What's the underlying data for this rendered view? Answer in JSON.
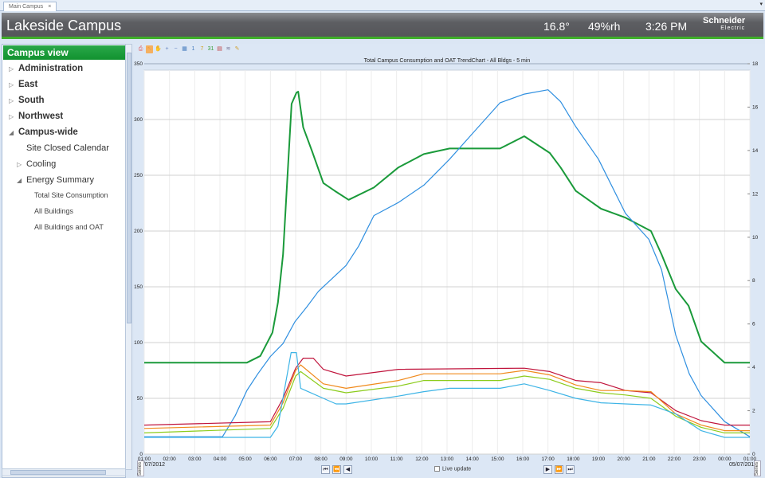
{
  "tab": {
    "label": "Main Campus",
    "close": "×"
  },
  "header": {
    "title": "Lakeside Campus",
    "temperature": "16.8°",
    "humidity": "49%rh",
    "time": "3:26 PM",
    "logo": "Schneider Electric",
    "logo_top": "Schneider",
    "logo_bottom": "Electric"
  },
  "sidebar": {
    "title": "Campus view",
    "items": [
      {
        "label": "Administration",
        "level": 0,
        "expander": "▷"
      },
      {
        "label": "East",
        "level": 0,
        "expander": "▷"
      },
      {
        "label": "South",
        "level": 0,
        "expander": "▷"
      },
      {
        "label": "Northwest",
        "level": 0,
        "expander": "▷"
      },
      {
        "label": "Campus-wide",
        "level": 0,
        "expander": "◢"
      },
      {
        "label": "Site Closed Calendar",
        "level": 1,
        "expander": ""
      },
      {
        "label": "Cooling",
        "level": 1,
        "expander": "▷"
      },
      {
        "label": "Energy Summary",
        "level": 1,
        "expander": "◢"
      },
      {
        "label": "Total Site Consumption",
        "level": 2,
        "expander": ""
      },
      {
        "label": "All Buildings",
        "level": 2,
        "expander": ""
      },
      {
        "label": "All Buildings and OAT",
        "level": 2,
        "expander": ""
      }
    ]
  },
  "toolbar": {
    "icons": [
      "print-icon",
      "pointer-icon",
      "pan-icon",
      "zoom-in-icon",
      "zoom-out-icon",
      "calendar-icon",
      "day-icon",
      "week-icon",
      "month-icon",
      "year-icon",
      "series-icon",
      "edit-icon"
    ]
  },
  "footer": {
    "start_date": "04/07/2012",
    "end_date": "05/07/2012",
    "live_update": "Live update",
    "series_tab": "Series"
  },
  "chart_data": {
    "type": "line",
    "title": "Total Campus Consumption and OAT TrendChart - All Bldgs - 5 min",
    "x_ticks": [
      "01:00",
      "02:00",
      "03:00",
      "04:00",
      "05:00",
      "06:00",
      "07:00",
      "08:00",
      "09:00",
      "10:00",
      "11:00",
      "12:00",
      "13:00",
      "14:00",
      "15:00",
      "16:00",
      "17:00",
      "18:00",
      "19:00",
      "20:00",
      "21:00",
      "22:00",
      "23:00",
      "00:00",
      "01:00"
    ],
    "xlim_hours": [
      1,
      25
    ],
    "ylim_left": [
      0,
      350
    ],
    "yticks_left": [
      0,
      50,
      100,
      150,
      200,
      250,
      300,
      350
    ],
    "ylim_right": [
      0,
      18
    ],
    "yticks_right": [
      0,
      2,
      4,
      6,
      8,
      10,
      12,
      14,
      16,
      18
    ],
    "grid": true,
    "series": [
      {
        "color": "#1a9a3a",
        "axis": "left",
        "width": 2,
        "points": [
          [
            1,
            82
          ],
          [
            5.07,
            82
          ],
          [
            5.6,
            88
          ],
          [
            6.08,
            109
          ],
          [
            6.3,
            136
          ],
          [
            6.5,
            179
          ],
          [
            6.84,
            314
          ],
          [
            7.03,
            324
          ],
          [
            7.1,
            325
          ],
          [
            7.3,
            293
          ],
          [
            7.66,
            271
          ],
          [
            8.1,
            243
          ],
          [
            8.55,
            236
          ],
          [
            9.1,
            228
          ],
          [
            10.1,
            239
          ],
          [
            11.07,
            257
          ],
          [
            12.08,
            269
          ],
          [
            13.1,
            274
          ],
          [
            15.1,
            274
          ],
          [
            16.06,
            285
          ],
          [
            17.07,
            270
          ],
          [
            17.5,
            257
          ],
          [
            18.1,
            236
          ],
          [
            19.1,
            220
          ],
          [
            20.07,
            212
          ],
          [
            21.08,
            200
          ],
          [
            21.5,
            179
          ],
          [
            22.06,
            148
          ],
          [
            22.57,
            133
          ],
          [
            23.07,
            101
          ],
          [
            24.0,
            82
          ],
          [
            25,
            82
          ]
        ]
      },
      {
        "color": "#2f8fe0",
        "axis": "right",
        "width": 1.2,
        "points": [
          [
            1,
            0.8
          ],
          [
            4.1,
            0.8
          ],
          [
            4.6,
            1.76
          ],
          [
            5.07,
            2.94
          ],
          [
            5.5,
            3.7
          ],
          [
            6.0,
            4.5
          ],
          [
            6.5,
            5.1
          ],
          [
            6.97,
            6.1
          ],
          [
            7.45,
            6.8
          ],
          [
            7.9,
            7.5
          ],
          [
            9.0,
            8.7
          ],
          [
            9.5,
            9.6
          ],
          [
            10.1,
            11.0
          ],
          [
            11.07,
            11.6
          ],
          [
            12.08,
            12.4
          ],
          [
            13.1,
            13.6
          ],
          [
            14.1,
            14.9
          ],
          [
            15.1,
            16.2
          ],
          [
            16.06,
            16.6
          ],
          [
            17.0,
            16.8
          ],
          [
            17.5,
            16.25
          ],
          [
            18.1,
            15.1
          ],
          [
            19.0,
            13.6
          ],
          [
            20.07,
            11.1
          ],
          [
            21.0,
            9.9
          ],
          [
            21.5,
            8.5
          ],
          [
            22.06,
            5.5
          ],
          [
            22.6,
            3.7
          ],
          [
            23.07,
            2.7
          ],
          [
            24.0,
            1.5
          ],
          [
            25,
            0.8
          ]
        ]
      },
      {
        "color": "#c0143c",
        "axis": "left",
        "width": 1.2,
        "points": [
          [
            1,
            26
          ],
          [
            6.0,
            29
          ],
          [
            6.5,
            50
          ],
          [
            7.0,
            77
          ],
          [
            7.3,
            86
          ],
          [
            7.7,
            86
          ],
          [
            8.1,
            76
          ],
          [
            9.0,
            70
          ],
          [
            11.07,
            76
          ],
          [
            16.06,
            77
          ],
          [
            17.07,
            74
          ],
          [
            18.1,
            66
          ],
          [
            19.1,
            64
          ],
          [
            20.07,
            57
          ],
          [
            21.08,
            55
          ],
          [
            22.06,
            39
          ],
          [
            23.07,
            30
          ],
          [
            24.0,
            26
          ],
          [
            25,
            26
          ]
        ]
      },
      {
        "color": "#f08a1c",
        "axis": "left",
        "width": 1.2,
        "points": [
          [
            1,
            23
          ],
          [
            6.0,
            26
          ],
          [
            6.5,
            46
          ],
          [
            7.0,
            75
          ],
          [
            7.2,
            80
          ],
          [
            8.1,
            63
          ],
          [
            9.0,
            59
          ],
          [
            11.07,
            66
          ],
          [
            12.08,
            72
          ],
          [
            15.1,
            72
          ],
          [
            16.06,
            75
          ],
          [
            17.07,
            71
          ],
          [
            18.1,
            62
          ],
          [
            19.1,
            57
          ],
          [
            20.07,
            57
          ],
          [
            21.08,
            56
          ],
          [
            22.06,
            36
          ],
          [
            23.07,
            26
          ],
          [
            24.0,
            21
          ],
          [
            25,
            21
          ]
        ]
      },
      {
        "color": "#8ccc1c",
        "axis": "left",
        "width": 1.2,
        "points": [
          [
            1,
            19
          ],
          [
            6.0,
            23
          ],
          [
            6.5,
            41
          ],
          [
            7.0,
            70
          ],
          [
            7.2,
            74
          ],
          [
            8.1,
            59
          ],
          [
            9.0,
            55
          ],
          [
            11.07,
            61
          ],
          [
            12.08,
            66
          ],
          [
            15.1,
            66
          ],
          [
            16.06,
            70
          ],
          [
            17.07,
            67
          ],
          [
            18.1,
            59
          ],
          [
            19.1,
            55
          ],
          [
            20.07,
            53
          ],
          [
            21.08,
            50
          ],
          [
            22.06,
            34
          ],
          [
            23.07,
            24
          ],
          [
            24.0,
            19
          ],
          [
            25,
            19
          ]
        ]
      },
      {
        "color": "#3db4e6",
        "axis": "left",
        "width": 1.2,
        "points": [
          [
            1,
            15
          ],
          [
            6.0,
            15
          ],
          [
            6.3,
            25
          ],
          [
            6.82,
            91
          ],
          [
            7.03,
            91
          ],
          [
            7.2,
            59
          ],
          [
            8.1,
            50
          ],
          [
            8.6,
            45
          ],
          [
            9.0,
            45
          ],
          [
            11.07,
            52
          ],
          [
            12.08,
            56
          ],
          [
            13.1,
            59
          ],
          [
            15.1,
            59
          ],
          [
            16.06,
            63
          ],
          [
            17.07,
            57
          ],
          [
            18.1,
            50
          ],
          [
            19.1,
            46
          ],
          [
            20.07,
            45
          ],
          [
            21.08,
            44
          ],
          [
            22.06,
            36
          ],
          [
            23.07,
            21
          ],
          [
            24.0,
            15
          ],
          [
            25,
            15
          ]
        ]
      }
    ]
  }
}
